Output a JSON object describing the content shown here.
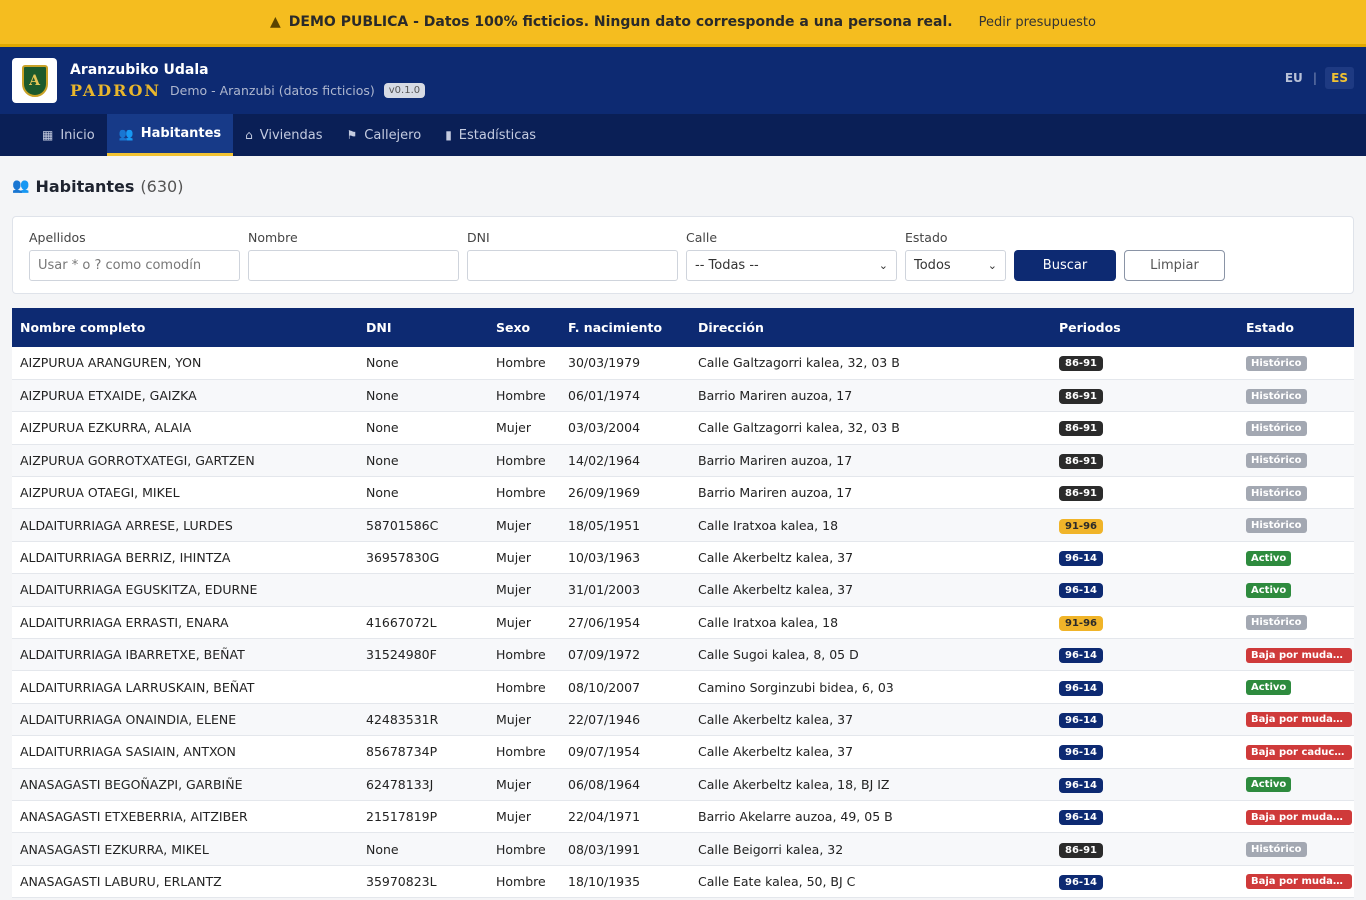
{
  "banner": {
    "text": "DEMO PUBLICA - Datos 100% ficticios. Ningun dato corresponde a una persona real.",
    "link": "Pedir presupuesto",
    "icon": "warning-icon"
  },
  "header": {
    "org": "Aranzubiko Udala",
    "app": "PADRON",
    "subtitle": "Demo - Aranzubi (datos ficticios)",
    "version": "v0.1.0",
    "logo_letter": "A",
    "lang_eu": "EU",
    "lang_sep": "|",
    "lang_es": "ES"
  },
  "nav": {
    "inicio": "Inicio",
    "habitantes": "Habitantes",
    "viviendas": "Viviendas",
    "callejero": "Callejero",
    "estadisticas": "Estadísticas"
  },
  "page": {
    "title": "Habitantes",
    "count": "(630)"
  },
  "filters": {
    "apellidos_label": "Apellidos",
    "apellidos_placeholder": "Usar * o ? como comodín",
    "nombre_label": "Nombre",
    "dni_label": "DNI",
    "calle_label": "Calle",
    "calle_value": "-- Todas --",
    "estado_label": "Estado",
    "estado_value": "Todos",
    "buscar": "Buscar",
    "limpiar": "Limpiar"
  },
  "table": {
    "headers": {
      "nombre": "Nombre completo",
      "dni": "DNI",
      "sexo": "Sexo",
      "fnac": "F. nacimiento",
      "direccion": "Dirección",
      "periodos": "Periodos",
      "estado": "Estado"
    },
    "rows": [
      {
        "nombre": "AIZPURUA ARANGUREN, YON",
        "dni": "None",
        "sexo": "Hombre",
        "fnac": "30/03/1979",
        "direccion": "Calle Galtzagorri kalea, 32, 03 B",
        "periodo": "86-91",
        "estado": "Histórico"
      },
      {
        "nombre": "AIZPURUA ETXAIDE, GAIZKA",
        "dni": "None",
        "sexo": "Hombre",
        "fnac": "06/01/1974",
        "direccion": "Barrio Mariren auzoa, 17",
        "periodo": "86-91",
        "estado": "Histórico"
      },
      {
        "nombre": "AIZPURUA EZKURRA, ALAIA",
        "dni": "None",
        "sexo": "Mujer",
        "fnac": "03/03/2004",
        "direccion": "Calle Galtzagorri kalea, 32, 03 B",
        "periodo": "86-91",
        "estado": "Histórico"
      },
      {
        "nombre": "AIZPURUA GORROTXATEGI, GARTZEN",
        "dni": "None",
        "sexo": "Hombre",
        "fnac": "14/02/1964",
        "direccion": "Barrio Mariren auzoa, 17",
        "periodo": "86-91",
        "estado": "Histórico"
      },
      {
        "nombre": "AIZPURUA OTAEGI, MIKEL",
        "dni": "None",
        "sexo": "Hombre",
        "fnac": "26/09/1969",
        "direccion": "Barrio Mariren auzoa, 17",
        "periodo": "86-91",
        "estado": "Histórico"
      },
      {
        "nombre": "ALDAITURRIAGA ARRESE, LURDES",
        "dni": "58701586C",
        "sexo": "Mujer",
        "fnac": "18/05/1951",
        "direccion": "Calle Iratxoa kalea, 18",
        "periodo": "91-96",
        "estado": "Histórico"
      },
      {
        "nombre": "ALDAITURRIAGA BERRIZ, IHINTZA",
        "dni": "36957830G",
        "sexo": "Mujer",
        "fnac": "10/03/1963",
        "direccion": "Calle Akerbeltz kalea, 37",
        "periodo": "96-14",
        "estado": "Activo"
      },
      {
        "nombre": "ALDAITURRIAGA EGUSKITZA, EDURNE",
        "dni": "",
        "sexo": "Mujer",
        "fnac": "31/01/2003",
        "direccion": "Calle Akerbeltz kalea, 37",
        "periodo": "96-14",
        "estado": "Activo"
      },
      {
        "nombre": "ALDAITURRIAGA ERRASTI, ENARA",
        "dni": "41667072L",
        "sexo": "Mujer",
        "fnac": "27/06/1954",
        "direccion": "Calle Iratxoa kalea, 18",
        "periodo": "91-96",
        "estado": "Histórico"
      },
      {
        "nombre": "ALDAITURRIAGA IBARRETXE, BEÑAT",
        "dni": "31524980F",
        "sexo": "Hombre",
        "fnac": "07/09/1972",
        "direccion": "Calle Sugoi kalea, 8, 05 D",
        "periodo": "96-14",
        "estado": "Baja por mudanza"
      },
      {
        "nombre": "ALDAITURRIAGA LARRUSKAIN, BEÑAT",
        "dni": "",
        "sexo": "Hombre",
        "fnac": "08/10/2007",
        "direccion": "Camino Sorginzubi bidea, 6, 03",
        "periodo": "96-14",
        "estado": "Activo"
      },
      {
        "nombre": "ALDAITURRIAGA ONAINDIA, ELENE",
        "dni": "42483531R",
        "sexo": "Mujer",
        "fnac": "22/07/1946",
        "direccion": "Calle Akerbeltz kalea, 37",
        "periodo": "96-14",
        "estado": "Baja por mudanza"
      },
      {
        "nombre": "ALDAITURRIAGA SASIAIN, ANTXON",
        "dni": "85678734P",
        "sexo": "Hombre",
        "fnac": "09/07/1954",
        "direccion": "Calle Akerbeltz kalea, 37",
        "periodo": "96-14",
        "estado": "Baja por caducidad"
      },
      {
        "nombre": "ANASAGASTI BEGOÑAZPI, GARBIÑE",
        "dni": "62478133J",
        "sexo": "Mujer",
        "fnac": "06/08/1964",
        "direccion": "Calle Akerbeltz kalea, 18, BJ IZ",
        "periodo": "96-14",
        "estado": "Activo"
      },
      {
        "nombre": "ANASAGASTI ETXEBERRIA, AITZIBER",
        "dni": "21517819P",
        "sexo": "Mujer",
        "fnac": "22/04/1971",
        "direccion": "Barrio Akelarre auzoa, 49, 05 B",
        "periodo": "96-14",
        "estado": "Baja por mudanza"
      },
      {
        "nombre": "ANASAGASTI EZKURRA, MIKEL",
        "dni": "None",
        "sexo": "Hombre",
        "fnac": "08/03/1991",
        "direccion": "Calle Beigorri kalea, 32",
        "periodo": "86-91",
        "estado": "Histórico"
      },
      {
        "nombre": "ANASAGASTI LABURU, ERLANTZ",
        "dni": "35970823L",
        "sexo": "Hombre",
        "fnac": "18/10/1935",
        "direccion": "Calle Eate kalea, 50, BJ C",
        "periodo": "96-14",
        "estado": "Baja por mudanza"
      }
    ]
  },
  "colors": {
    "primary": "#0d2a72",
    "accent": "#f1c232",
    "periodos": {
      "86-91": "#2b2b2b",
      "91-96": "#f0b429",
      "96-14": "#0d2a72"
    },
    "estados": {
      "Histórico": "#a3a8b2",
      "Activo": "#2e8b3e",
      "Baja por mudanza": "#cf3a3a",
      "Baja por caducidad": "#cf3a3a"
    }
  }
}
